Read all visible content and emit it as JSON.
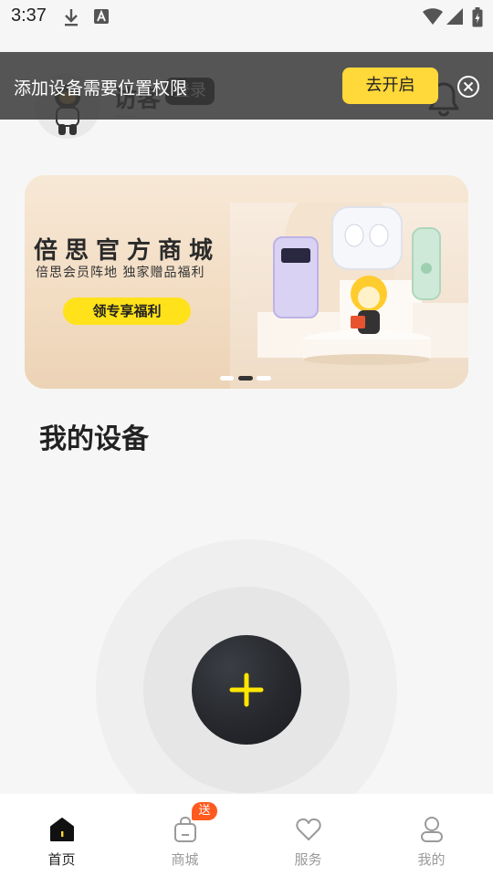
{
  "status_bar": {
    "time": "3:37",
    "icons": [
      "download-icon",
      "font-a-icon",
      "wifi-icon",
      "cell-signal-icon",
      "battery-icon"
    ]
  },
  "header": {
    "visitor_name": "访客",
    "visitor_sub": "——",
    "login_label": "登录",
    "notification_icon": "bell-icon"
  },
  "permission_banner": {
    "text": "添加设备需要位置权限",
    "enable_label": "去开启",
    "close_icon": "close-circle-icon"
  },
  "promo": {
    "title": "倍思官方商城",
    "subtitle": "倍思会员阵地  独家赠品福利",
    "cta_label": "领专享福利",
    "page_count": 3,
    "active_page": 2
  },
  "devices": {
    "section_title": "我的设备",
    "add_icon": "plus-icon"
  },
  "bottom_nav": {
    "items": [
      {
        "label": "首页",
        "icon": "home-icon",
        "active": true
      },
      {
        "label": "商城",
        "icon": "shopping-bag-icon",
        "badge": "送"
      },
      {
        "label": "服务",
        "icon": "heart-icon"
      },
      {
        "label": "我的",
        "icon": "person-icon"
      }
    ]
  },
  "colors": {
    "accent": "#ffd83a",
    "banner_button": "#ffe21a",
    "badge": "#ff5a1f",
    "add_plus": "#ffe600",
    "dark": "#1c1d21"
  }
}
